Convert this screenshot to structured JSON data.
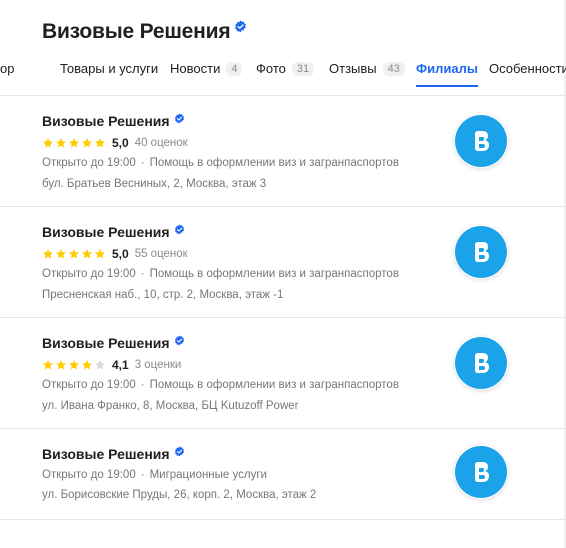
{
  "header": {
    "title": "Визовые Решения",
    "verified": true
  },
  "tabs": [
    {
      "label": "ор",
      "count": null,
      "active": false
    },
    {
      "label": "Товары и услуги",
      "count": null,
      "active": false
    },
    {
      "label": "Новости",
      "count": "4",
      "active": false
    },
    {
      "label": "Фото",
      "count": "31",
      "active": false
    },
    {
      "label": "Отзывы",
      "count": "43",
      "active": false
    },
    {
      "label": "Филиалы",
      "count": null,
      "active": true
    },
    {
      "label": "Особенности",
      "count": null,
      "active": false
    }
  ],
  "branches": [
    {
      "name": "Визовые Решения",
      "rating": "5,0",
      "stars": 5,
      "reviews": "40 оценок",
      "hours": "Открыто до 19:00",
      "category": "Помощь в оформлении виз и загранпаспортов",
      "address": "бул. Братьев Весниных, 2, Москва, этаж 3"
    },
    {
      "name": "Визовые Решения",
      "rating": "5,0",
      "stars": 5,
      "reviews": "55 оценок",
      "hours": "Открыто до 19:00",
      "category": "Помощь в оформлении виз и загранпаспортов",
      "address": "Пресненская наб., 10, стр. 2, Москва, этаж -1"
    },
    {
      "name": "Визовые Решения",
      "rating": "4,1",
      "stars": 4,
      "reviews": "3 оценки",
      "hours": "Открыто до 19:00",
      "category": "Помощь в оформлении виз и загранпаспортов",
      "address": "ул. Ивана Франко, 8, Москва, БЦ Kutuzoff Power"
    },
    {
      "name": "Визовые Решения",
      "rating": null,
      "stars": 0,
      "reviews": null,
      "hours": "Открыто до 19:00",
      "category": "Миграционные услуги",
      "address": "ул. Борисовские Пруды, 26, корп. 2, Москва, этаж 2"
    }
  ],
  "colors": {
    "accent": "#1f66f5",
    "star": "#ffcc00",
    "star_empty": "#d9d9d9",
    "logo_bg": "#1aa3e8",
    "verified": "#1f66f5"
  },
  "icons": {
    "verified": "verified-badge-icon",
    "star": "star-icon",
    "logo": "company-logo-icon"
  }
}
